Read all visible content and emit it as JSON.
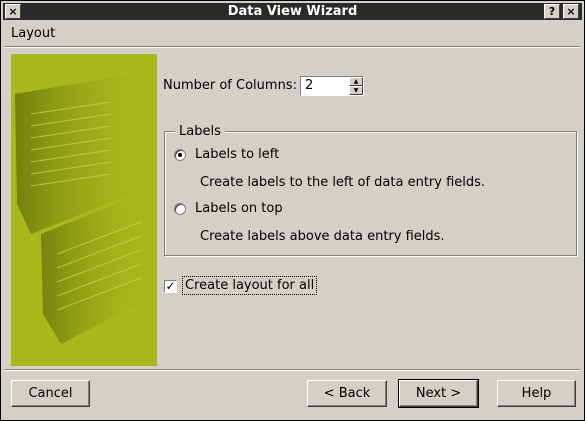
{
  "window": {
    "title": "Data View Wizard",
    "close_glyph": "×",
    "help_glyph": "?",
    "close2_glyph": "×"
  },
  "page": {
    "heading": "Layout"
  },
  "columns": {
    "label": "Number of Columns:",
    "value": "2"
  },
  "labels_group": {
    "title": "Labels",
    "left": {
      "label": "Labels to left",
      "desc": "Create labels to the left of data entry fields.",
      "selected": true
    },
    "top": {
      "label": "Labels on top",
      "desc": "Create labels above data entry fields.",
      "selected": false
    }
  },
  "create_all": {
    "label": "Create layout for all",
    "checked": true
  },
  "buttons": {
    "cancel": "Cancel",
    "back": "< Back",
    "next": "Next >",
    "help": "Help"
  },
  "colors": {
    "art": "#a8b81a",
    "titlebar": "#2a2a2a"
  }
}
